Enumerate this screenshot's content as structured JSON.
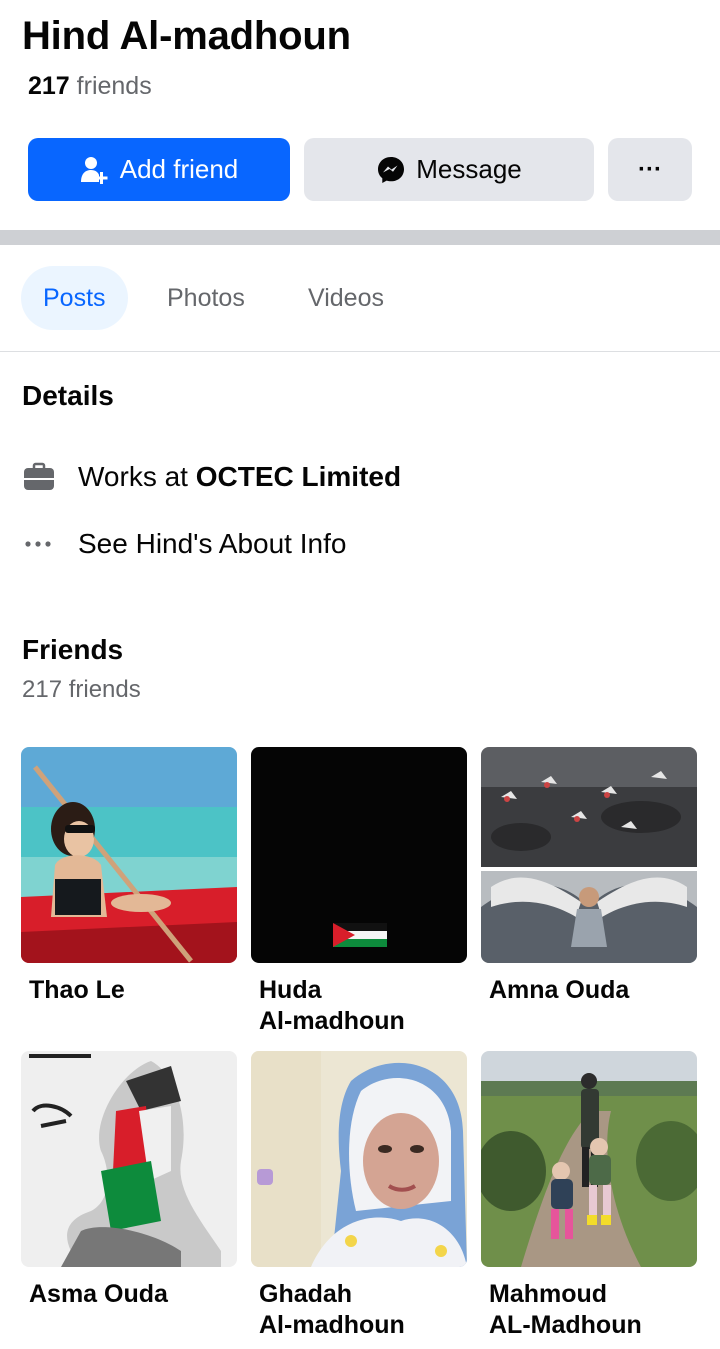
{
  "profile": {
    "name": "Hind Al-madhoun",
    "friend_count": "217",
    "friend_count_suffix": "friends"
  },
  "actions": {
    "add_friend": "Add friend",
    "message": "Message",
    "more": "···"
  },
  "tabs": [
    {
      "label": "Posts",
      "active": true
    },
    {
      "label": "Photos",
      "active": false
    },
    {
      "label": "Videos",
      "active": false
    }
  ],
  "details": {
    "title": "Details",
    "work_prefix": "Works at ",
    "work_company": "OCTEC Limited",
    "about": "See Hind's About Info"
  },
  "friends": {
    "title": "Friends",
    "subtitle": "217 friends",
    "list": [
      {
        "name": "Thao Le"
      },
      {
        "name": "Huda Al-madhoun"
      },
      {
        "name": "Amna Ouda"
      },
      {
        "name": "Asma Ouda"
      },
      {
        "name": "Ghadah Al-madhoun"
      },
      {
        "name": "Mahmoud AL-Madhoun"
      }
    ]
  },
  "colors": {
    "accent": "#0866ff",
    "button_gray": "#e4e6eb",
    "tab_active_bg": "#ebf5ff",
    "secondary_text": "#65676b"
  }
}
